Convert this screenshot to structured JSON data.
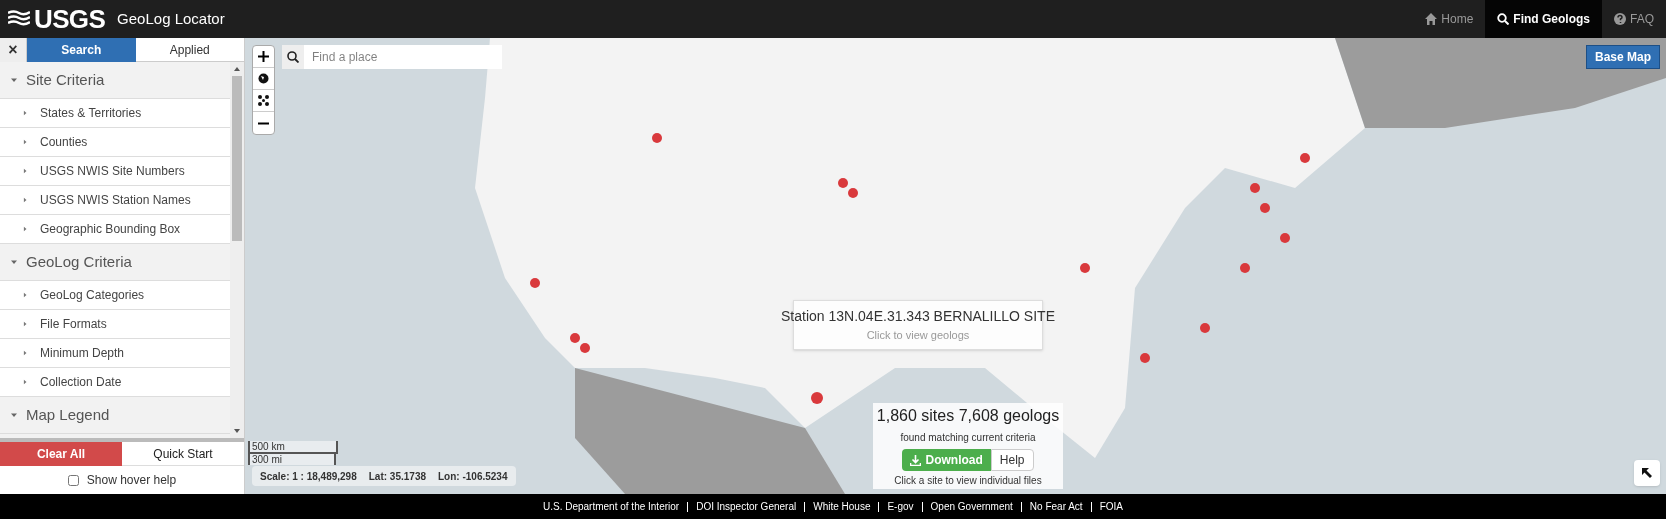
{
  "header": {
    "logo_text": "USGS",
    "app_title": "GeoLog Locator",
    "nav": [
      {
        "label": "Home",
        "selected": false
      },
      {
        "label": "Find Geologs",
        "selected": true
      },
      {
        "label": "FAQ",
        "selected": false
      }
    ]
  },
  "sidebar": {
    "close_label": "×",
    "tabs": [
      {
        "label": "Search",
        "selected": true
      },
      {
        "label": "Applied",
        "selected": false
      }
    ],
    "sections": [
      {
        "title": "Site Criteria",
        "expanded": true,
        "items": [
          "States & Territories",
          "Counties",
          "USGS NWIS Site Numbers",
          "USGS NWIS Station Names",
          "Geographic Bounding Box"
        ]
      },
      {
        "title": "GeoLog Criteria",
        "expanded": true,
        "items": [
          "GeoLog Categories",
          "File Formats",
          "Minimum Depth",
          "Collection Date"
        ]
      },
      {
        "title": "Map Legend",
        "expanded": true
      }
    ],
    "buttons": [
      {
        "label": "Clear All",
        "kind": "danger"
      },
      {
        "label": "Quick Start",
        "kind": "plain"
      }
    ],
    "hover_help": {
      "label": "Show hover help",
      "checked": false
    }
  },
  "map": {
    "search_placeholder": "Find a place",
    "base_map_label": "Base Map",
    "scale_bar": [
      "500 km",
      "300 mi"
    ],
    "scale": "Scale: 1 : 18,489,298",
    "lat": "Lat: 35.1738",
    "lon": "Lon: -106.5234",
    "tooltip": {
      "title": "Station 13N.04E.31.343 BERNALILLO SITE",
      "subtitle": "Click to view geologs"
    },
    "results": {
      "headline": "1,860 sites 7,608 geologs",
      "subtitle": "found matching current criteria",
      "download_label": "Download",
      "help_label": "Help",
      "note": "Click a site to view individual files"
    }
  },
  "footer": [
    "U.S. Department of the Interior",
    "DOI Inspector General",
    "White House",
    "E-gov",
    "Open Government",
    "No Fear Act",
    "FOIA"
  ]
}
